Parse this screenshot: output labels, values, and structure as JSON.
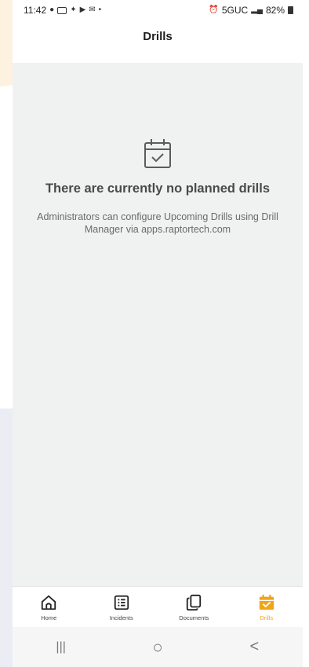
{
  "status_bar": {
    "time": "11:42",
    "network": "5GUC",
    "battery": "82%"
  },
  "header": {
    "title": "Drills"
  },
  "empty_state": {
    "icon": "calendar-check-icon",
    "title": "There are currently no planned drills",
    "description": "Administrators can configure Upcoming Drills using Drill Manager via apps.raptortech.com"
  },
  "bottom_nav": {
    "active": "Drills",
    "accent_color": "#f2a417",
    "items": [
      {
        "label": "Home",
        "icon": "home-icon"
      },
      {
        "label": "Incidents",
        "icon": "list-icon"
      },
      {
        "label": "Documents",
        "icon": "documents-icon"
      },
      {
        "label": "Drills",
        "icon": "calendar-check-icon"
      }
    ]
  },
  "system_nav": {
    "items": [
      {
        "icon": "recents-icon",
        "glyph": "|||"
      },
      {
        "icon": "home-circle-icon",
        "glyph": "○"
      },
      {
        "icon": "back-icon",
        "glyph": "<"
      }
    ]
  }
}
